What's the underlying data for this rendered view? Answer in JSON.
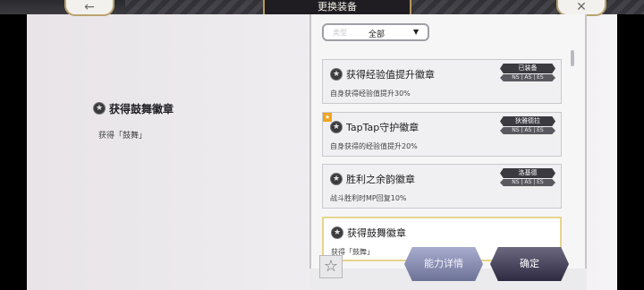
{
  "header": {
    "title": "更换装备",
    "back_glyph": "←",
    "close_glyph": "✕"
  },
  "detail": {
    "title": "获得鼓舞徽章",
    "description": "获得「鼓舞」"
  },
  "filter": {
    "label": "类型",
    "value": "全部",
    "caret": "▼"
  },
  "cards": [
    {
      "title": "获得经验值提升徽章",
      "description": "自身获得经验值提升30%",
      "owner": "已装备",
      "versions": "NS | AS | ES"
    },
    {
      "title": "TapTap守护徽章",
      "description": "自身获得的经验值提升20%",
      "owner": "狄雅德拉",
      "versions": "NS | AS | ES"
    },
    {
      "title": "胜利之余韵徽章",
      "description": "战斗胜利时MP回复10%",
      "owner": "洛基德",
      "versions": "NS | AS | ES"
    },
    {
      "title": "获得鼓舞徽章",
      "description": "获得「鼓舞」"
    }
  ],
  "buttons": {
    "ability": "能力详情",
    "confirm": "确定",
    "star_glyph": "☆"
  },
  "colors": {
    "accent": "#b49a5a",
    "selected_border": "#e5d58d"
  }
}
